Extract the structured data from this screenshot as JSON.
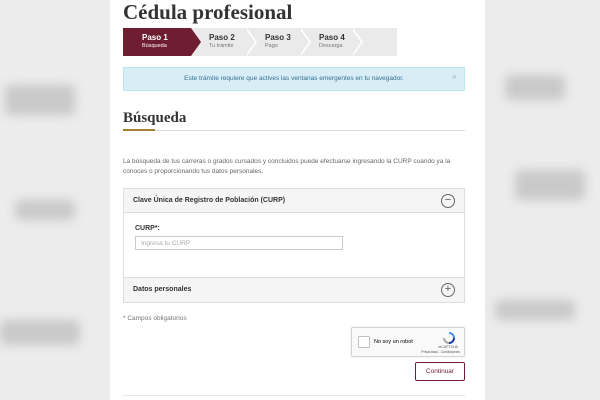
{
  "header": {
    "title": "Cédula profesional"
  },
  "stepper": {
    "steps": [
      {
        "name": "Paso 1",
        "sub": "Búsqueda"
      },
      {
        "name": "Paso 2",
        "sub": "Tu trámite"
      },
      {
        "name": "Paso 3",
        "sub": "Pago"
      },
      {
        "name": "Paso 4",
        "sub": "Descarga"
      }
    ],
    "active_color": "#6f1d31"
  },
  "alert": {
    "message": "Este trámite requiere que actives las ventanas emergentes en tu navegador.",
    "close": "×"
  },
  "search": {
    "title": "Búsqueda",
    "intro": "La búsqueda de tus carreras o grados cursados y concluidos puede efectuarse ingresando la CURP cuando ya la conoces o proporcionando tus datos personales."
  },
  "panel_curp": {
    "header": "Clave Única de Registro de Población (CURP)",
    "toggle": "−",
    "label": "CURP*:",
    "placeholder": "Ingresa tu CURP"
  },
  "panel_personal": {
    "header": "Datos personales",
    "toggle": "+"
  },
  "required_note": "* Campos obligatorios",
  "recaptcha": {
    "label": "No soy un robot",
    "brand": "reCAPTCHA",
    "links": "Privacidad - Condiciones"
  },
  "actions": {
    "continue": "Continuar"
  }
}
